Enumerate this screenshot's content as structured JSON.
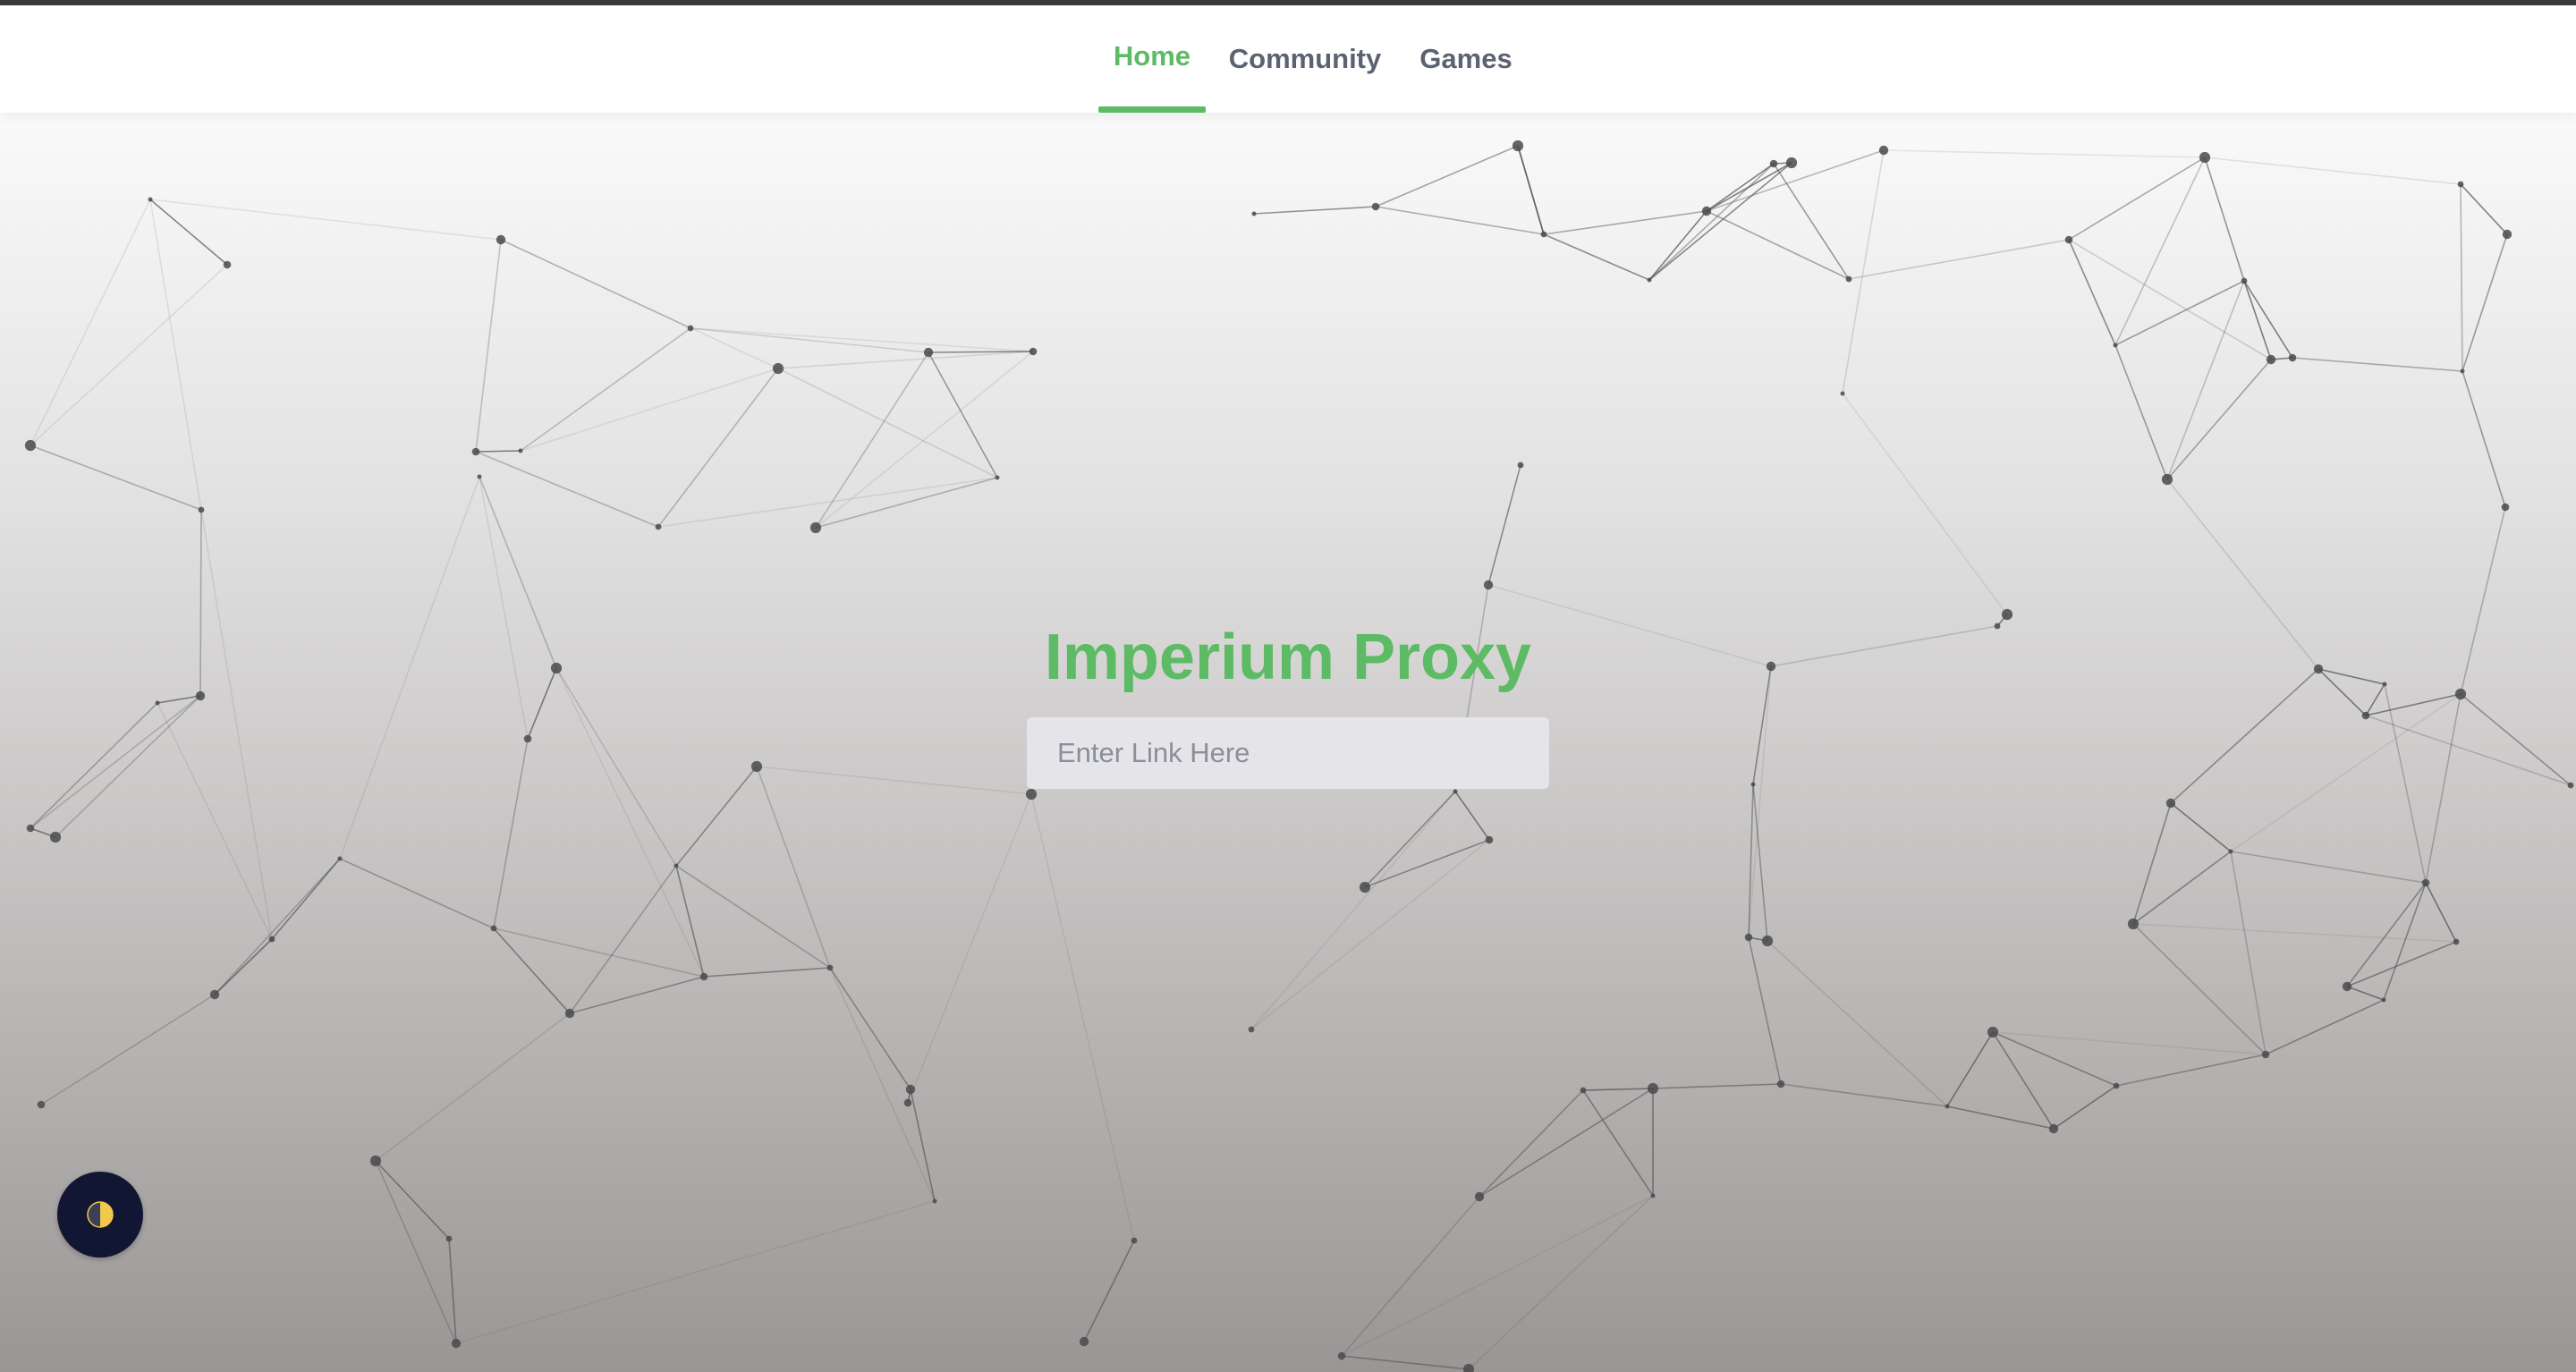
{
  "nav": {
    "items": [
      {
        "label": "Home",
        "active": true
      },
      {
        "label": "Community",
        "active": false
      },
      {
        "label": "Games",
        "active": false
      }
    ]
  },
  "hero": {
    "title": "Imperium Proxy",
    "link_input": {
      "placeholder": "Enter Link Here",
      "value": ""
    }
  },
  "theme_toggle": {
    "icon": "half-moon-icon"
  },
  "colors": {
    "accent": "#5cbb64",
    "nav_text": "#5b6270",
    "toggle_bg": "#111633",
    "toggle_icon": "#f2c94c",
    "network_line": "#555555",
    "network_node": "#4a4a4a"
  }
}
